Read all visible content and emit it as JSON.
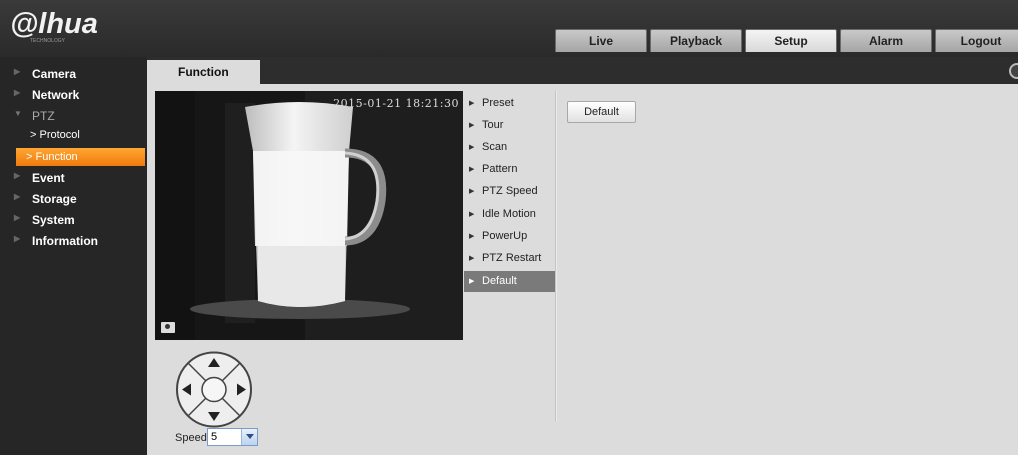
{
  "brand": {
    "logo_text": "@lhua",
    "logo_sub": "TECHNOLOGY"
  },
  "header": {
    "tabs": [
      {
        "label": "Live"
      },
      {
        "label": "Playback"
      },
      {
        "label": "Setup",
        "active": true
      },
      {
        "label": "Alarm"
      },
      {
        "label": "Logout"
      }
    ]
  },
  "page": {
    "tab_label": "Function"
  },
  "sidebar": {
    "items": [
      {
        "label": "Camera"
      },
      {
        "label": "Network"
      },
      {
        "label": "PTZ",
        "open": true
      },
      {
        "label": "Protocol",
        "sub": true
      },
      {
        "label": "Function",
        "sub": true,
        "active": true
      },
      {
        "label": "Event"
      },
      {
        "label": "Storage"
      },
      {
        "label": "System"
      },
      {
        "label": "Information"
      }
    ]
  },
  "video": {
    "timestamp": "2015-01-21 18:21:30"
  },
  "ptz_menu": {
    "items": [
      {
        "label": "Preset"
      },
      {
        "label": "Tour"
      },
      {
        "label": "Scan"
      },
      {
        "label": "Pattern"
      },
      {
        "label": "PTZ Speed"
      },
      {
        "label": "Idle Motion"
      },
      {
        "label": "PowerUp"
      },
      {
        "label": "PTZ Restart"
      },
      {
        "label": "Default",
        "active": true
      }
    ]
  },
  "panel": {
    "default_button": "Default"
  },
  "controls": {
    "speed_label": "Speed",
    "speed_value": "5"
  },
  "colors": {
    "accent": "#f28a1a",
    "background": "#dcdcdc",
    "sidebar": "#262626"
  }
}
